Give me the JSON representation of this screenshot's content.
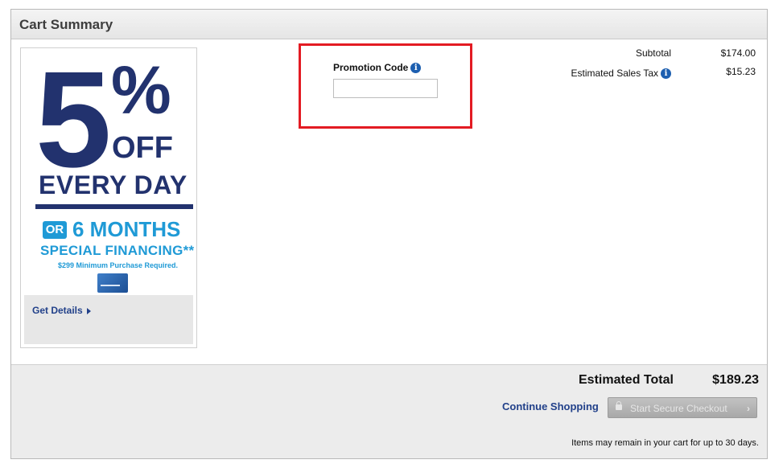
{
  "panel": {
    "title": "Cart Summary"
  },
  "promo_banner": {
    "big_number": "5",
    "percent": "%",
    "off": "OFF",
    "every_day": "EVERY DAY",
    "or_badge": "OR",
    "months": "6 MONTHS",
    "special": "SPECIAL FINANCING**",
    "minimum": "$299 Minimum Purchase Required.",
    "get_details": "Get Details"
  },
  "promotion": {
    "label": "Promotion Code",
    "info_icon": "info-icon",
    "input_value": "",
    "input_placeholder": ""
  },
  "summary": {
    "subtotal_label": "Subtotal",
    "subtotal_value": "$174.00",
    "tax_label": "Estimated Sales Tax",
    "tax_value": "$15.23"
  },
  "footer": {
    "estimated_total_label": "Estimated Total",
    "estimated_total_value": "$189.23",
    "continue_shopping": "Continue Shopping",
    "checkout_button": "Start Secure Checkout",
    "note": "Items may remain in your cart for up to 30 days."
  },
  "colors": {
    "navy": "#22326e",
    "blue": "#1f9ad6",
    "link": "#22418a",
    "highlight": "#e31b23"
  }
}
